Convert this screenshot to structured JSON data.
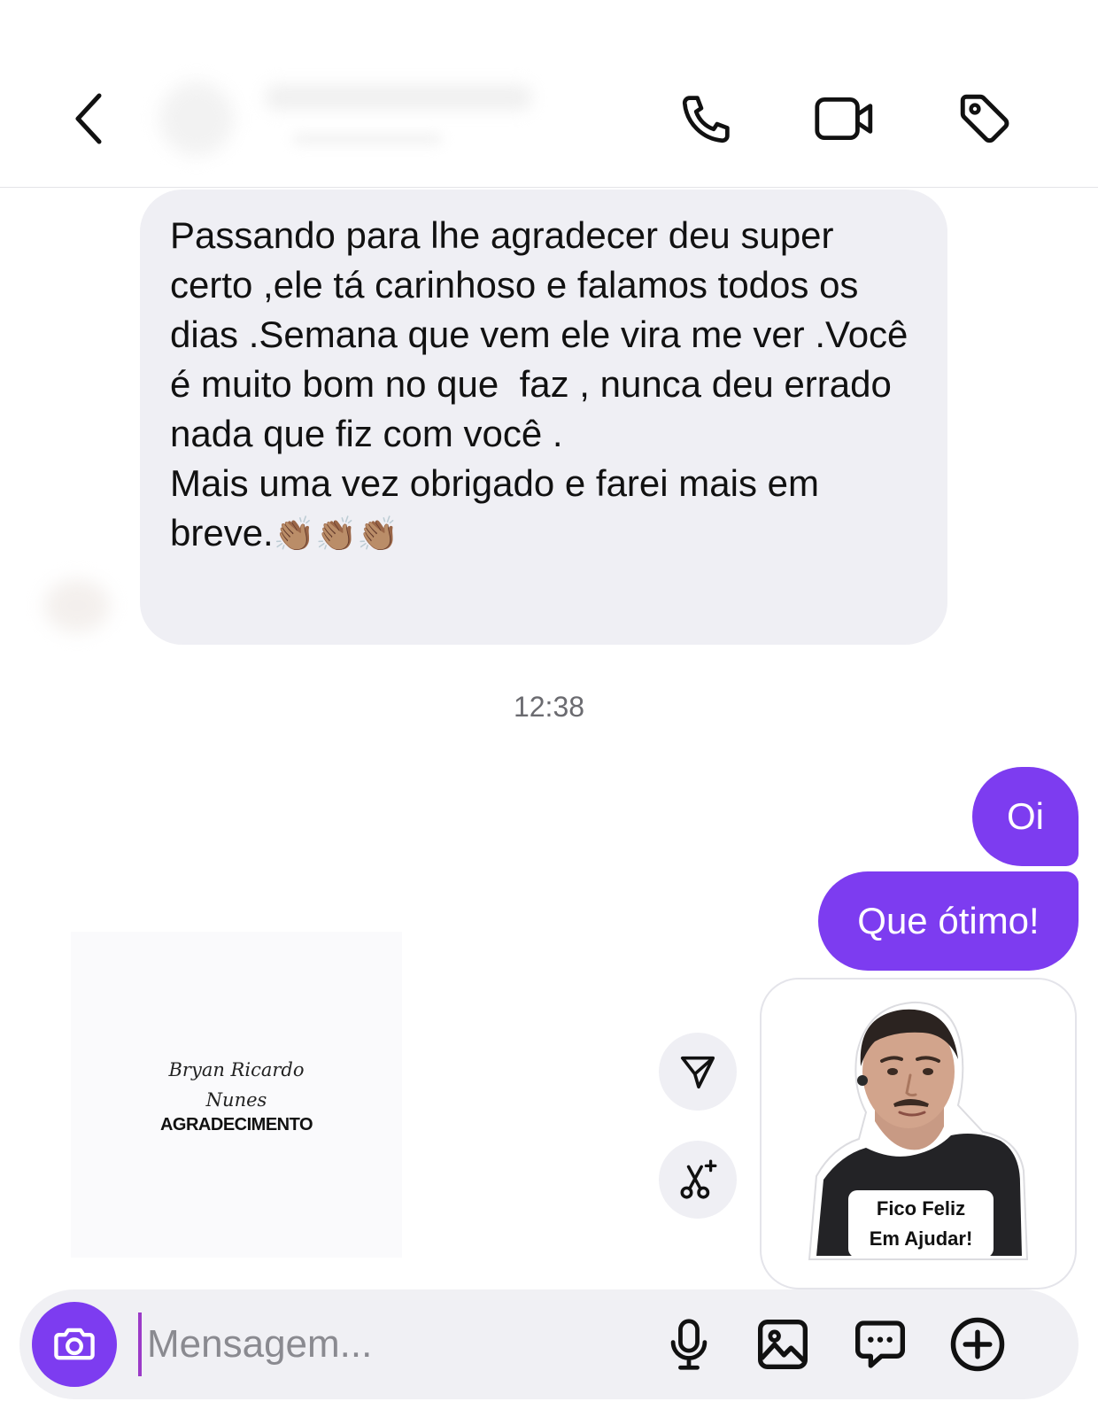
{
  "header": {
    "contact_name": "",
    "back_icon": "chevron-left-icon",
    "call_icon": "phone-icon",
    "video_icon": "video-camera-icon",
    "tag_icon": "tag-icon"
  },
  "messages": {
    "received_text": "Passando para lhe agradecer deu super certo ,ele tá carinhoso e falamos todos os dias .Semana que vem ele vira me ver .Você é muito bom no que  faz , nunca deu errado nada que fiz com você .\nMais uma vez obrigado e farei mais em breve.",
    "received_emoji": "👏🏽👏🏽👏🏽",
    "timestamp": "12:38",
    "sent_1": "Oi",
    "sent_2": "Que ótimo!"
  },
  "shared_card": {
    "script_name": "Bryan Ricardo Nunes",
    "title": "AGRADECIMENTO"
  },
  "side_actions": {
    "share_icon": "send-icon",
    "remix_icon": "scissors-sparkle-icon"
  },
  "sticker": {
    "caption_line1": "Fico Feliz",
    "caption_line2": "Em Ajudar!"
  },
  "composer": {
    "placeholder": "Mensagem...",
    "camera_icon": "camera-icon",
    "mic_icon": "microphone-icon",
    "gallery_icon": "image-icon",
    "chat_icon": "chat-bubble-icon",
    "add_icon": "plus-circle-icon"
  },
  "colors": {
    "accent": "#7d3cf0",
    "received_bubble": "#efeff4"
  }
}
